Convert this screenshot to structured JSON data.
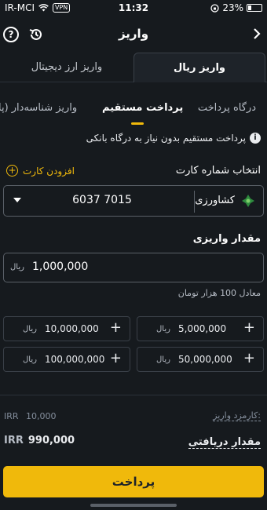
{
  "status_bar": {
    "carrier": "IR-MCI",
    "vpn": "VPN",
    "time": "11:32",
    "battery": "23%"
  },
  "header": {
    "title": "واریز"
  },
  "segments": {
    "active": "واریز ریال",
    "inactive": "واریز ارز دیجیتال"
  },
  "sub_tabs": {
    "gateway": "درگاه پرداخت",
    "direct": "پرداخت مستقیم",
    "id_deposit": "واریز شناسه‌دار (پا"
  },
  "info": {
    "text": "پرداخت مستقیم بدون نیاز به درگاه بانکی"
  },
  "card": {
    "label": "انتخاب شماره کارت",
    "add_label": "افزودن کارت",
    "number": "6037 7015",
    "bank": "کشاورزی"
  },
  "amount": {
    "label": "مقدار واریزی",
    "value": "1,000,000",
    "currency": "ریال",
    "equivalent": "معادل 100 هزار تومان"
  },
  "presets": [
    {
      "value": "10,000,000",
      "currency": "ریال"
    },
    {
      "value": "5,000,000",
      "currency": "ریال"
    },
    {
      "value": "100,000,000",
      "currency": "ریال"
    },
    {
      "value": "50,000,000",
      "currency": "ریال"
    }
  ],
  "summary": {
    "fee_label": "کارمزد واریز:",
    "fee_currency": "IRR",
    "fee_value": "10,000",
    "receive_label": "مقدار دریافتی",
    "receive_currency": "IRR",
    "receive_value": "990,000"
  },
  "pay_button": "پرداخت",
  "colors": {
    "accent": "#f0b90b",
    "background": "#161a1e",
    "bank_green": "#2e8b3e"
  }
}
